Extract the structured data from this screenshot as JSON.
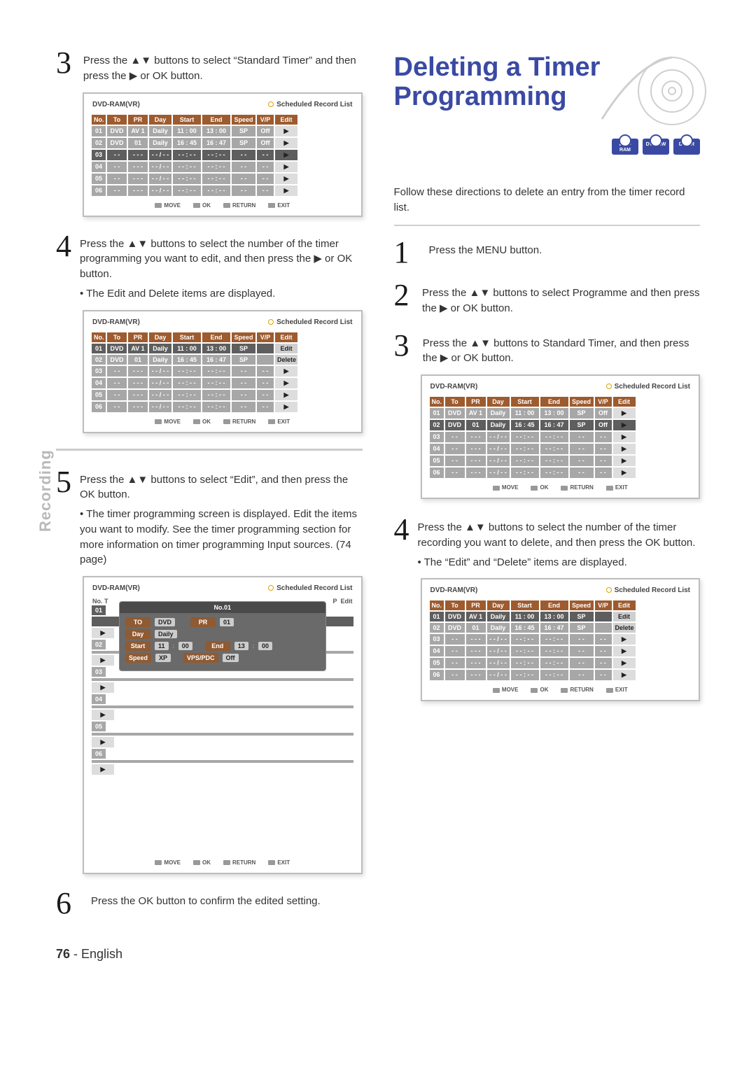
{
  "page": {
    "number": "76",
    "lang": "English"
  },
  "sideLabel": "Recording",
  "left": {
    "step3": {
      "text": "Press the ▲▼ buttons to select “Standard Timer” and then press the ▶ or OK button."
    },
    "step4": {
      "text": "Press the ▲▼ buttons to select the number of the timer programming you want to edit, and then press the ▶ or OK button.",
      "sub": "• The Edit and Delete items are displayed."
    },
    "step5": {
      "text": "Press the ▲▼ buttons to select “Edit”, and then press the OK button.",
      "sub": "• The timer programming screen is displayed. Edit the items you want to modify. See the timer programming section for more information on timer programming Input sources. (74 page)"
    },
    "step6": {
      "text": "Press the OK button to confirm the edited setting."
    }
  },
  "right": {
    "title": "Deleting a Timer Programming",
    "badges": [
      "DVD-RAM",
      "DVD-RW",
      "DVD-R"
    ],
    "lead": "Follow these directions to delete an entry from the timer record list.",
    "step1": {
      "text": "Press the MENU button."
    },
    "step2": {
      "text": "Press the ▲▼ buttons to select Programme and then press the ▶ or OK button."
    },
    "step3": {
      "text": "Press the ▲▼ buttons to Standard Timer, and then press the ▶ or OK button."
    },
    "step4": {
      "text": "Press the ▲▼ buttons to select the number of the timer recording you want to delete, and then press the OK button.",
      "sub": "• The “Edit” and “Delete” items are displayed."
    }
  },
  "osd": {
    "label": "DVD-RAM(VR)",
    "listTitle": "Scheduled Record List",
    "headers": [
      "No.",
      "To",
      "PR",
      "Day",
      "Start",
      "End",
      "Speed",
      "V/P",
      "Edit"
    ],
    "footer": {
      "move": "MOVE",
      "ok": "OK",
      "return": "RETURN",
      "exit": "EXIT"
    },
    "A": {
      "rows": [
        {
          "no": "01",
          "to": "DVD",
          "pr": "AV 1",
          "day": "Daily",
          "start": "11 : 00",
          "end": "13 : 00",
          "spd": "SP",
          "vp": "Off",
          "ed": "▶"
        },
        {
          "no": "02",
          "to": "DVD",
          "pr": "01",
          "day": "Daily",
          "start": "16 : 45",
          "end": "16 : 47",
          "spd": "SP",
          "vp": "Off",
          "ed": "▶"
        },
        {
          "no": "03",
          "to": "- -",
          "pr": "- - -",
          "day": "- - / - -",
          "start": "- - : - -",
          "end": "- - : - -",
          "spd": "- -",
          "vp": "- -",
          "ed": "▶"
        },
        {
          "no": "04",
          "to": "- -",
          "pr": "- - -",
          "day": "- - / - -",
          "start": "- - : - -",
          "end": "- - : - -",
          "spd": "- -",
          "vp": "- -",
          "ed": "▶"
        },
        {
          "no": "05",
          "to": "- -",
          "pr": "- - -",
          "day": "- - / - -",
          "start": "- - : - -",
          "end": "- - : - -",
          "spd": "- -",
          "vp": "- -",
          "ed": "▶"
        },
        {
          "no": "06",
          "to": "- -",
          "pr": "- - -",
          "day": "- - / - -",
          "start": "- - : - -",
          "end": "- - : - -",
          "spd": "- -",
          "vp": "- -",
          "ed": "▶"
        }
      ],
      "selectedIndex": 2
    },
    "B": {
      "rows": [
        {
          "no": "01",
          "to": "DVD",
          "pr": "AV 1",
          "day": "Daily",
          "start": "11 : 00",
          "end": "13 : 00",
          "spd": "SP",
          "vp": "",
          "ed": "Edit"
        },
        {
          "no": "02",
          "to": "DVD",
          "pr": "01",
          "day": "Daily",
          "start": "16 : 45",
          "end": "16 : 47",
          "spd": "SP",
          "vp": "",
          "ed": "Delete"
        },
        {
          "no": "03",
          "to": "- -",
          "pr": "- - -",
          "day": "- - / - -",
          "start": "- - : - -",
          "end": "- - : - -",
          "spd": "- -",
          "vp": "- -",
          "ed": "▶"
        },
        {
          "no": "04",
          "to": "- -",
          "pr": "- - -",
          "day": "- - / - -",
          "start": "- - : - -",
          "end": "- - : - -",
          "spd": "- -",
          "vp": "- -",
          "ed": "▶"
        },
        {
          "no": "05",
          "to": "- -",
          "pr": "- - -",
          "day": "- - / - -",
          "start": "- - : - -",
          "end": "- - : - -",
          "spd": "- -",
          "vp": "- -",
          "ed": "▶"
        },
        {
          "no": "06",
          "to": "- -",
          "pr": "- - -",
          "day": "- - / - -",
          "start": "- - : - -",
          "end": "- - : - -",
          "spd": "- -",
          "vp": "- -",
          "ed": "▶"
        }
      ],
      "selectedIndex": 0,
      "editButtons": [
        0,
        1
      ]
    },
    "C": {
      "overlayTitle": "No.01",
      "rowsLeft": [
        "01",
        "02",
        "03",
        "04",
        "05",
        "06"
      ],
      "editSide": "Edit",
      "fields": {
        "to_label": "TO",
        "to_val": "DVD",
        "pr_label": "PR",
        "pr_val": "01",
        "day_label": "Day",
        "day_val": "Daily",
        "start_label": "Start",
        "start_h": "11",
        "start_m": "00",
        "end_label": "End",
        "end_h": "13",
        "end_m": "00",
        "speed_label": "Speed",
        "speed_val": "XP",
        "vps_label": "VPS/PDC",
        "vps_val": "Off"
      }
    },
    "D": {
      "rows": [
        {
          "no": "01",
          "to": "DVD",
          "pr": "AV 1",
          "day": "Daily",
          "start": "11 : 00",
          "end": "13 : 00",
          "spd": "SP",
          "vp": "Off",
          "ed": "▶"
        },
        {
          "no": "02",
          "to": "DVD",
          "pr": "01",
          "day": "Daily",
          "start": "16 : 45",
          "end": "16 : 47",
          "spd": "SP",
          "vp": "Off",
          "ed": "▶"
        },
        {
          "no": "03",
          "to": "- -",
          "pr": "- - -",
          "day": "- - / - -",
          "start": "- - : - -",
          "end": "- - : - -",
          "spd": "- -",
          "vp": "- -",
          "ed": "▶"
        },
        {
          "no": "04",
          "to": "- -",
          "pr": "- - -",
          "day": "- - / - -",
          "start": "- - : - -",
          "end": "- - : - -",
          "spd": "- -",
          "vp": "- -",
          "ed": "▶"
        },
        {
          "no": "05",
          "to": "- -",
          "pr": "- - -",
          "day": "- - / - -",
          "start": "- - : - -",
          "end": "- - : - -",
          "spd": "- -",
          "vp": "- -",
          "ed": "▶"
        },
        {
          "no": "06",
          "to": "- -",
          "pr": "- - -",
          "day": "- - / - -",
          "start": "- - : - -",
          "end": "- - : - -",
          "spd": "- -",
          "vp": "- -",
          "ed": "▶"
        }
      ],
      "selectedIndex": 1
    },
    "E": {
      "rows": [
        {
          "no": "01",
          "to": "DVD",
          "pr": "AV 1",
          "day": "Daily",
          "start": "11 : 00",
          "end": "13 : 00",
          "spd": "SP",
          "vp": "",
          "ed": "Edit"
        },
        {
          "no": "02",
          "to": "DVD",
          "pr": "01",
          "day": "Daily",
          "start": "16 : 45",
          "end": "16 : 47",
          "spd": "SP",
          "vp": "",
          "ed": "Delete"
        },
        {
          "no": "03",
          "to": "- -",
          "pr": "- - -",
          "day": "- - / - -",
          "start": "- - : - -",
          "end": "- - : - -",
          "spd": "- -",
          "vp": "- -",
          "ed": "▶"
        },
        {
          "no": "04",
          "to": "- -",
          "pr": "- - -",
          "day": "- - / - -",
          "start": "- - : - -",
          "end": "- - : - -",
          "spd": "- -",
          "vp": "- -",
          "ed": "▶"
        },
        {
          "no": "05",
          "to": "- -",
          "pr": "- - -",
          "day": "- - / - -",
          "start": "- - : - -",
          "end": "- - : - -",
          "spd": "- -",
          "vp": "- -",
          "ed": "▶"
        },
        {
          "no": "06",
          "to": "- -",
          "pr": "- - -",
          "day": "- - / - -",
          "start": "- - : - -",
          "end": "- - : - -",
          "spd": "- -",
          "vp": "- -",
          "ed": "▶"
        }
      ],
      "selectedIndex": 0,
      "editButtons": [
        0,
        1
      ]
    }
  }
}
